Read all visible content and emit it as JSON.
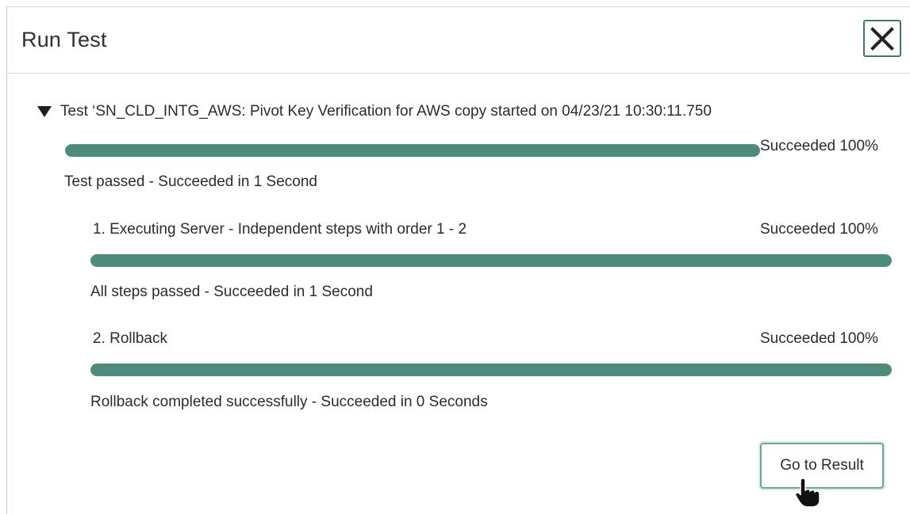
{
  "dialog": {
    "title": "Run Test",
    "close_icon": "close-icon"
  },
  "test": {
    "toggle_icon": "triangle-down-icon",
    "title": "Test ‘SN_CLD_INTG_AWS: Pivot Key Verification for AWS copy  started on 04/23/21 10:30:11.750",
    "status": "Succeeded 100%",
    "progress": 1.0,
    "summary": "Test passed - Succeeded in 1 Second"
  },
  "steps": [
    {
      "title": "1. Executing Server - Independent steps with order 1 - 2",
      "status": "Succeeded 100%",
      "progress": 1.0,
      "summary": "All steps passed - Succeeded in 1 Second"
    },
    {
      "title": "2. Rollback",
      "status": "Succeeded 100%",
      "progress": 1.0,
      "summary": "Rollback completed successfully - Succeeded in 0 Seconds"
    }
  ],
  "actions": {
    "go_to_result_label": "Go to Result"
  },
  "cursor_icon": "hand-pointer-icon",
  "colors": {
    "progress_fill": "#4d8c7c",
    "button_border": "#3d7a6a"
  }
}
